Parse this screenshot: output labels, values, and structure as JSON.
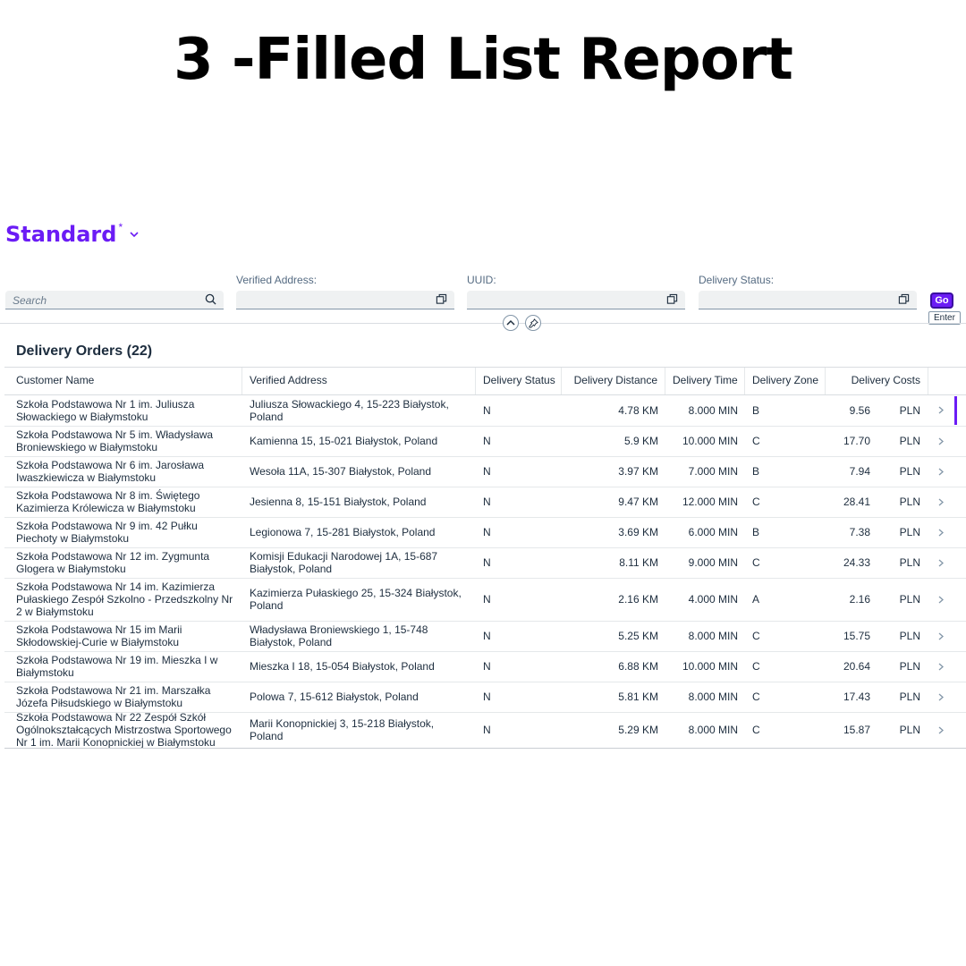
{
  "headline": "3 -Filled List Report",
  "variant": {
    "title": "Standard",
    "modified": "*"
  },
  "filters": {
    "search_placeholder": "Search",
    "verified_address_label": "Verified Address:",
    "uuid_label": "UUID:",
    "delivery_status_label": "Delivery Status:",
    "go_label": "Go",
    "go_tooltip": "Enter"
  },
  "table": {
    "title": "Delivery Orders (22)",
    "columns": [
      "Customer Name",
      "Verified Address",
      "Delivery Status",
      "Delivery Distance",
      "Delivery Time",
      "Delivery Zone",
      "Delivery Costs"
    ],
    "rows": [
      {
        "name": "Szkoła Podstawowa Nr 1 im. Juliusza Słowackiego w Białymstoku",
        "address": "Juliusza Słowackiego 4, 15-223 Białystok, Poland",
        "status": "N",
        "distance": "4.78 KM",
        "time": "8.000 MIN",
        "zone": "B",
        "cost": "9.56",
        "currency": "PLN"
      },
      {
        "name": "Szkoła Podstawowa Nr 5 im. Władysława Broniewskiego w Białymstoku",
        "address": "Kamienna 15, 15-021 Białystok, Poland",
        "status": "N",
        "distance": "5.9 KM",
        "time": "10.000 MIN",
        "zone": "C",
        "cost": "17.70",
        "currency": "PLN"
      },
      {
        "name": "Szkoła Podstawowa Nr 6 im. Jarosława Iwaszkiewicza w Białymstoku",
        "address": "Wesoła 11A, 15-307 Białystok, Poland",
        "status": "N",
        "distance": "3.97 KM",
        "time": "7.000 MIN",
        "zone": "B",
        "cost": "7.94",
        "currency": "PLN"
      },
      {
        "name": "Szkoła Podstawowa Nr 8 im. Świętego Kazimierza Królewicza w Białymstoku",
        "address": "Jesienna 8, 15-151 Białystok, Poland",
        "status": "N",
        "distance": "9.47 KM",
        "time": "12.000 MIN",
        "zone": "C",
        "cost": "28.41",
        "currency": "PLN"
      },
      {
        "name": "Szkoła Podstawowa Nr 9 im. 42 Pułku Piechoty w Białymstoku",
        "address": "Legionowa 7, 15-281 Białystok, Poland",
        "status": "N",
        "distance": "3.69 KM",
        "time": "6.000 MIN",
        "zone": "B",
        "cost": "7.38",
        "currency": "PLN"
      },
      {
        "name": "Szkoła Podstawowa Nr 12 im. Zygmunta Glogera w Białymstoku",
        "address": "Komisji Edukacji Narodowej 1A, 15-687 Białystok, Poland",
        "status": "N",
        "distance": "8.11 KM",
        "time": "9.000 MIN",
        "zone": "C",
        "cost": "24.33",
        "currency": "PLN"
      },
      {
        "name": "Szkoła Podstawowa Nr 14 im. Kazimierza Pułaskiego Zespół Szkolno - Przedszkolny Nr 2 w Białymstoku",
        "address": "Kazimierza Pułaskiego 25, 15-324 Białystok, Poland",
        "status": "N",
        "distance": "2.16 KM",
        "time": "4.000 MIN",
        "zone": "A",
        "cost": "2.16",
        "currency": "PLN"
      },
      {
        "name": "Szkoła Podstawowa Nr 15 im Marii Skłodowskiej-Curie w Białymstoku",
        "address": "Władysława Broniewskiego 1, 15-748 Białystok, Poland",
        "status": "N",
        "distance": "5.25 KM",
        "time": "8.000 MIN",
        "zone": "C",
        "cost": "15.75",
        "currency": "PLN"
      },
      {
        "name": "Szkoła Podstawowa Nr 19 im. Mieszka I w Białymstoku",
        "address": "Mieszka I 18, 15-054 Białystok, Poland",
        "status": "N",
        "distance": "6.88 KM",
        "time": "10.000 MIN",
        "zone": "C",
        "cost": "20.64",
        "currency": "PLN"
      },
      {
        "name": "Szkoła Podstawowa Nr 21 im. Marszałka Józefa Piłsudskiego w Białymstoku",
        "address": "Polowa 7, 15-612 Białystok, Poland",
        "status": "N",
        "distance": "5.81 KM",
        "time": "8.000 MIN",
        "zone": "C",
        "cost": "17.43",
        "currency": "PLN"
      },
      {
        "name": "Szkoła Podstawowa Nr 22 Zespół Szkół Ogólnokształcących Mistrzostwa Sportowego Nr 1 im. Marii Konopnickiej w Białymstoku",
        "address": "Marii Konopnickiej 3, 15-218 Białystok, Poland",
        "status": "N",
        "distance": "5.29 KM",
        "time": "8.000 MIN",
        "zone": "C",
        "cost": "15.87",
        "currency": "PLN"
      }
    ]
  },
  "icons": {
    "search": "search-icon",
    "value_help": "value-help-icon",
    "collapse": "chevron-up-icon",
    "pin": "pin-icon",
    "row_nav": "chevron-right-icon"
  },
  "colors": {
    "accent": "#6b1cf5",
    "text": "#1d2d3e",
    "field_bg": "#eff1f2"
  }
}
